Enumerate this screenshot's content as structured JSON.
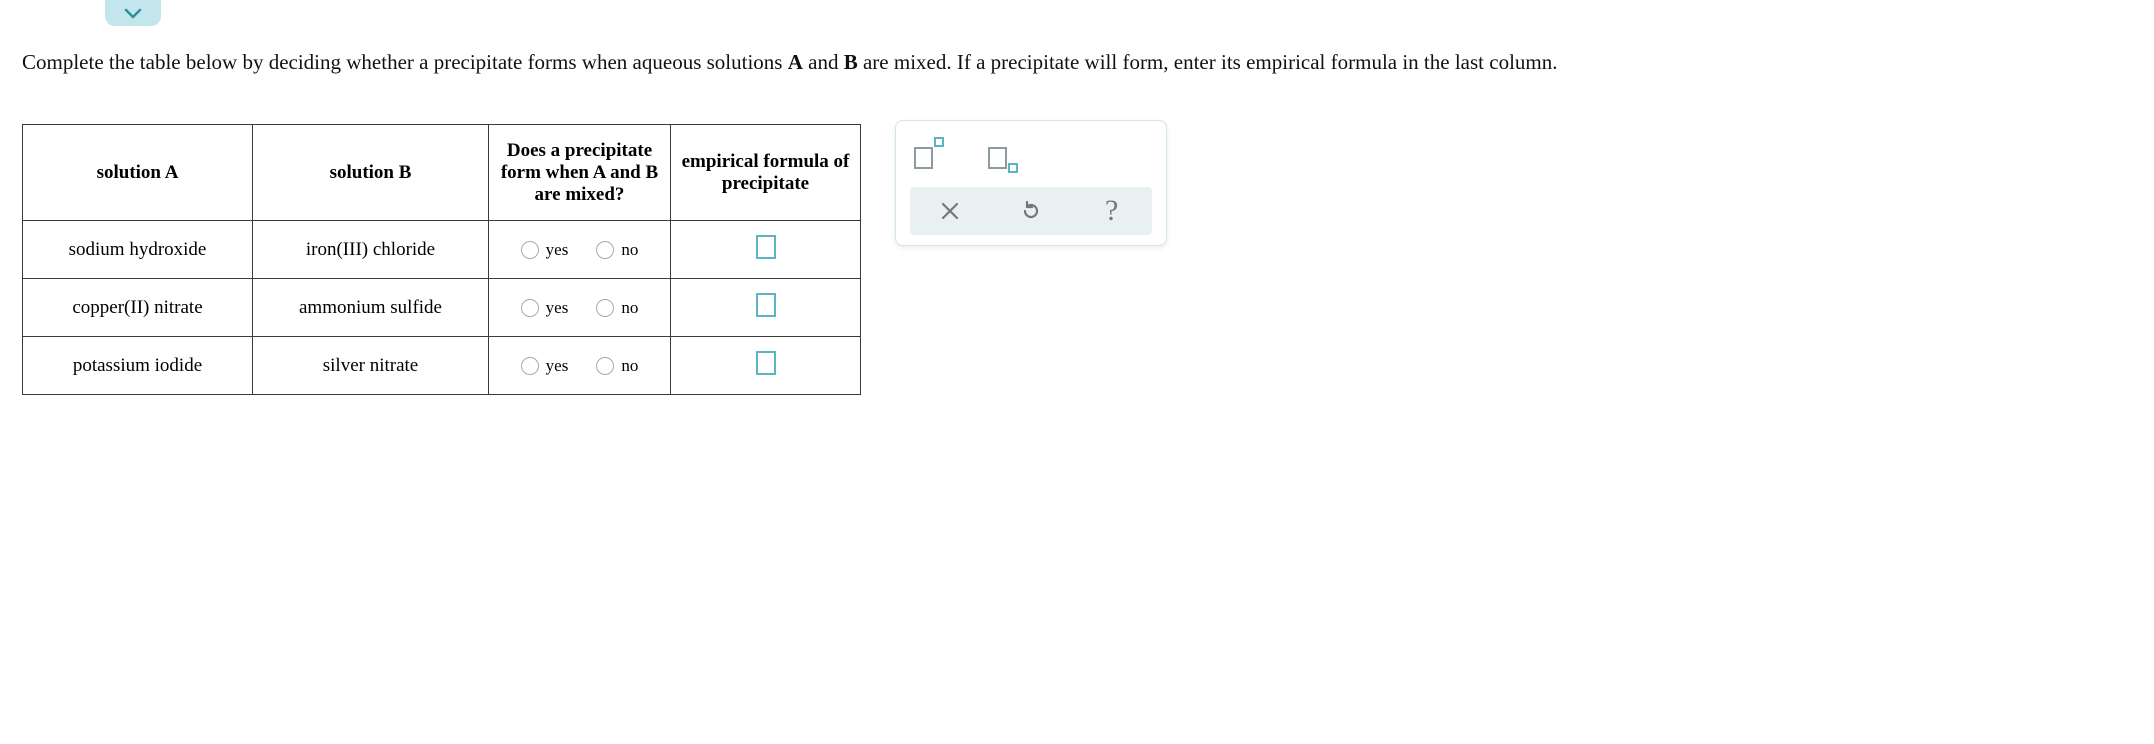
{
  "instructions": {
    "pre": "Complete the table below by deciding whether a precipitate forms when aqueous solutions ",
    "A": "A",
    "mid": " and ",
    "B": "B",
    "post": " are mixed. If a precipitate will form, enter its empirical formula in the last column."
  },
  "table": {
    "headers": {
      "solA": "solution A",
      "solB": "solution B",
      "mix": "Does a precipitate form when A and B are mixed?",
      "formula": "empirical formula of precipitate"
    },
    "radioLabels": {
      "yes": "yes",
      "no": "no"
    },
    "rows": [
      {
        "a": "sodium hydroxide",
        "b": "iron(III) chloride"
      },
      {
        "a": "copper(II) nitrate",
        "b": "ammonium sulfide"
      },
      {
        "a": "potassium iodide",
        "b": "silver nitrate"
      }
    ]
  },
  "keypad": {
    "superscript": "superscript",
    "subscript": "subscript",
    "clear": "clear",
    "reset": "reset",
    "help": "?"
  }
}
